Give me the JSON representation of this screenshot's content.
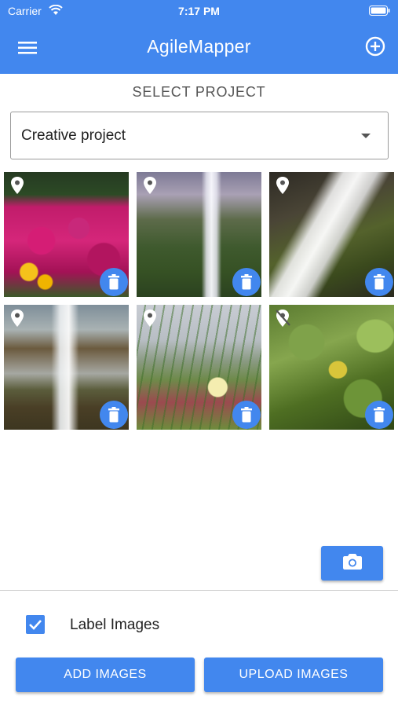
{
  "status_bar": {
    "carrier": "Carrier",
    "time": "7:17 PM",
    "wifi_icon": "wifi-icon",
    "battery_icon": "battery-icon"
  },
  "app_bar": {
    "title": "AgileMapper",
    "menu_icon": "hamburger-menu-icon",
    "add_icon": "add-circle-icon",
    "color": "#4287ee"
  },
  "project_select": {
    "label": "SELECT PROJECT",
    "selected": "Creative project"
  },
  "images": [
    {
      "subject": "pink flowers",
      "has_location": true
    },
    {
      "subject": "waterfall",
      "has_location": true
    },
    {
      "subject": "waterfall close-up",
      "has_location": true
    },
    {
      "subject": "waterfall with rocks",
      "has_location": true
    },
    {
      "subject": "coastal grass",
      "has_location": true
    },
    {
      "subject": "green leaves",
      "has_location": false
    }
  ],
  "actions": {
    "camera_icon": "camera-icon",
    "label_images": "Label Images",
    "label_images_checked": true,
    "add_images": "ADD IMAGES",
    "upload_images": "UPLOAD IMAGES"
  }
}
